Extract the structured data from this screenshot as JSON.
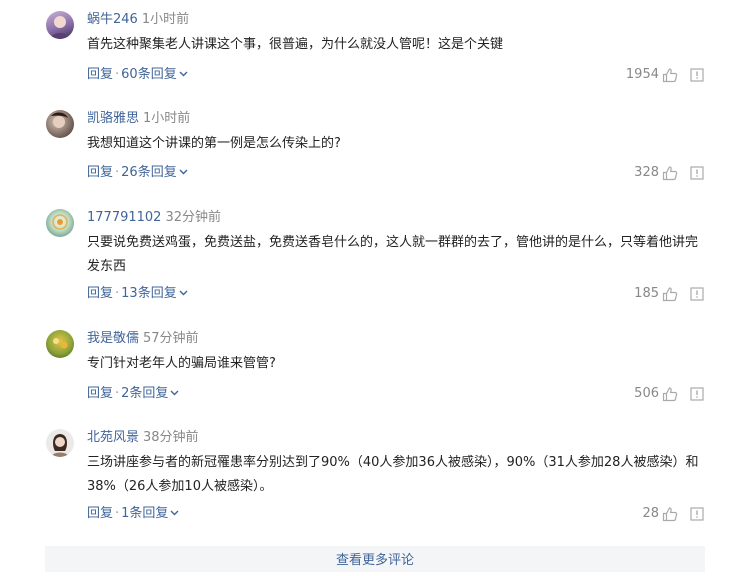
{
  "comments": [
    {
      "user": "蜗牛246",
      "time": "1小时前",
      "text": "首先这种聚集老人讲课这个事，很普遍，为什么就没人管呢！这是个关键",
      "reply_label": "回复",
      "replies": "60条回复",
      "likes": "1954"
    },
    {
      "user": "凯骆雅思",
      "time": "1小时前",
      "text": "我想知道这个讲课的第一例是怎么传染上的?",
      "reply_label": "回复",
      "replies": "26条回复",
      "likes": "328"
    },
    {
      "user": "177791102",
      "time": "32分钟前",
      "text": "只要说免费送鸡蛋，免费送盐，免费送香皂什么的，这人就一群群的去了，管他讲的是什么，只等着他讲完发东西",
      "reply_label": "回复",
      "replies": "13条回复",
      "likes": "185"
    },
    {
      "user": "我是敬儒",
      "time": "57分钟前",
      "text": "专门针对老年人的骗局谁来管管?",
      "reply_label": "回复",
      "replies": "2条回复",
      "likes": "506"
    },
    {
      "user": "北苑风景",
      "time": "38分钟前",
      "text": "三场讲座参与者的新冠罹患率分别达到了90%（40人参加36人被感染），90%（31人参加28人被感染）和38%（26人参加10人被感染）。",
      "reply_label": "回复",
      "replies": "1条回复",
      "likes": "28"
    }
  ],
  "separator": "·",
  "more_label": "查看更多评论",
  "colors": {
    "link": "#406599",
    "muted": "#888888",
    "more_bg": "#f4f5f7"
  }
}
